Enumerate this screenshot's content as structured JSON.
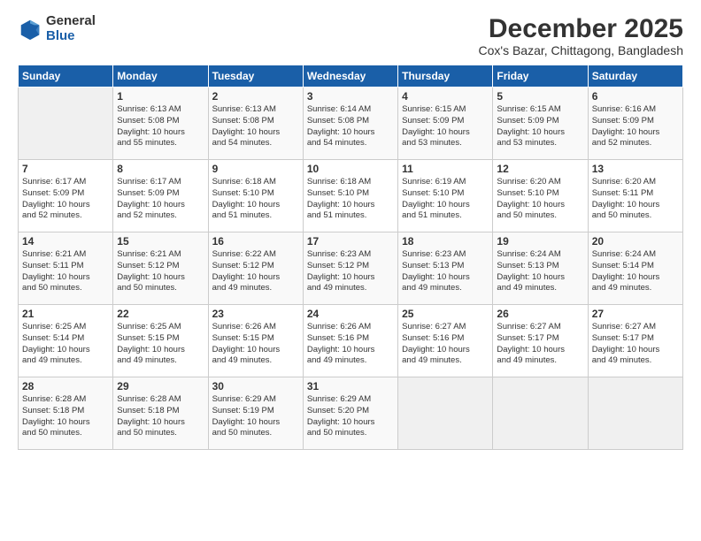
{
  "header": {
    "logo_general": "General",
    "logo_blue": "Blue",
    "month_title": "December 2025",
    "subtitle": "Cox's Bazar, Chittagong, Bangladesh"
  },
  "calendar": {
    "days_of_week": [
      "Sunday",
      "Monday",
      "Tuesday",
      "Wednesday",
      "Thursday",
      "Friday",
      "Saturday"
    ],
    "weeks": [
      [
        {
          "day": "",
          "info": ""
        },
        {
          "day": "1",
          "info": "Sunrise: 6:13 AM\nSunset: 5:08 PM\nDaylight: 10 hours\nand 55 minutes."
        },
        {
          "day": "2",
          "info": "Sunrise: 6:13 AM\nSunset: 5:08 PM\nDaylight: 10 hours\nand 54 minutes."
        },
        {
          "day": "3",
          "info": "Sunrise: 6:14 AM\nSunset: 5:08 PM\nDaylight: 10 hours\nand 54 minutes."
        },
        {
          "day": "4",
          "info": "Sunrise: 6:15 AM\nSunset: 5:09 PM\nDaylight: 10 hours\nand 53 minutes."
        },
        {
          "day": "5",
          "info": "Sunrise: 6:15 AM\nSunset: 5:09 PM\nDaylight: 10 hours\nand 53 minutes."
        },
        {
          "day": "6",
          "info": "Sunrise: 6:16 AM\nSunset: 5:09 PM\nDaylight: 10 hours\nand 52 minutes."
        }
      ],
      [
        {
          "day": "7",
          "info": "Sunrise: 6:17 AM\nSunset: 5:09 PM\nDaylight: 10 hours\nand 52 minutes."
        },
        {
          "day": "8",
          "info": "Sunrise: 6:17 AM\nSunset: 5:09 PM\nDaylight: 10 hours\nand 52 minutes."
        },
        {
          "day": "9",
          "info": "Sunrise: 6:18 AM\nSunset: 5:10 PM\nDaylight: 10 hours\nand 51 minutes."
        },
        {
          "day": "10",
          "info": "Sunrise: 6:18 AM\nSunset: 5:10 PM\nDaylight: 10 hours\nand 51 minutes."
        },
        {
          "day": "11",
          "info": "Sunrise: 6:19 AM\nSunset: 5:10 PM\nDaylight: 10 hours\nand 51 minutes."
        },
        {
          "day": "12",
          "info": "Sunrise: 6:20 AM\nSunset: 5:10 PM\nDaylight: 10 hours\nand 50 minutes."
        },
        {
          "day": "13",
          "info": "Sunrise: 6:20 AM\nSunset: 5:11 PM\nDaylight: 10 hours\nand 50 minutes."
        }
      ],
      [
        {
          "day": "14",
          "info": "Sunrise: 6:21 AM\nSunset: 5:11 PM\nDaylight: 10 hours\nand 50 minutes."
        },
        {
          "day": "15",
          "info": "Sunrise: 6:21 AM\nSunset: 5:12 PM\nDaylight: 10 hours\nand 50 minutes."
        },
        {
          "day": "16",
          "info": "Sunrise: 6:22 AM\nSunset: 5:12 PM\nDaylight: 10 hours\nand 49 minutes."
        },
        {
          "day": "17",
          "info": "Sunrise: 6:23 AM\nSunset: 5:12 PM\nDaylight: 10 hours\nand 49 minutes."
        },
        {
          "day": "18",
          "info": "Sunrise: 6:23 AM\nSunset: 5:13 PM\nDaylight: 10 hours\nand 49 minutes."
        },
        {
          "day": "19",
          "info": "Sunrise: 6:24 AM\nSunset: 5:13 PM\nDaylight: 10 hours\nand 49 minutes."
        },
        {
          "day": "20",
          "info": "Sunrise: 6:24 AM\nSunset: 5:14 PM\nDaylight: 10 hours\nand 49 minutes."
        }
      ],
      [
        {
          "day": "21",
          "info": "Sunrise: 6:25 AM\nSunset: 5:14 PM\nDaylight: 10 hours\nand 49 minutes."
        },
        {
          "day": "22",
          "info": "Sunrise: 6:25 AM\nSunset: 5:15 PM\nDaylight: 10 hours\nand 49 minutes."
        },
        {
          "day": "23",
          "info": "Sunrise: 6:26 AM\nSunset: 5:15 PM\nDaylight: 10 hours\nand 49 minutes."
        },
        {
          "day": "24",
          "info": "Sunrise: 6:26 AM\nSunset: 5:16 PM\nDaylight: 10 hours\nand 49 minutes."
        },
        {
          "day": "25",
          "info": "Sunrise: 6:27 AM\nSunset: 5:16 PM\nDaylight: 10 hours\nand 49 minutes."
        },
        {
          "day": "26",
          "info": "Sunrise: 6:27 AM\nSunset: 5:17 PM\nDaylight: 10 hours\nand 49 minutes."
        },
        {
          "day": "27",
          "info": "Sunrise: 6:27 AM\nSunset: 5:17 PM\nDaylight: 10 hours\nand 49 minutes."
        }
      ],
      [
        {
          "day": "28",
          "info": "Sunrise: 6:28 AM\nSunset: 5:18 PM\nDaylight: 10 hours\nand 50 minutes."
        },
        {
          "day": "29",
          "info": "Sunrise: 6:28 AM\nSunset: 5:18 PM\nDaylight: 10 hours\nand 50 minutes."
        },
        {
          "day": "30",
          "info": "Sunrise: 6:29 AM\nSunset: 5:19 PM\nDaylight: 10 hours\nand 50 minutes."
        },
        {
          "day": "31",
          "info": "Sunrise: 6:29 AM\nSunset: 5:20 PM\nDaylight: 10 hours\nand 50 minutes."
        },
        {
          "day": "",
          "info": ""
        },
        {
          "day": "",
          "info": ""
        },
        {
          "day": "",
          "info": ""
        }
      ]
    ]
  }
}
